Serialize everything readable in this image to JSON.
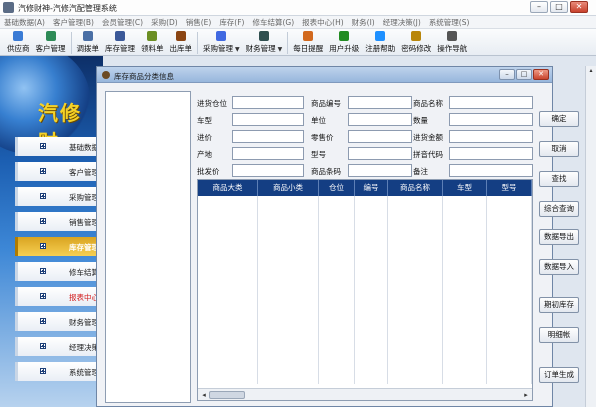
{
  "window": {
    "title": "汽修财神-汽修汽配管理系统",
    "buttons": {
      "min": "–",
      "max": "□",
      "close": "✕"
    }
  },
  "menubar": [
    "基础数据(A)",
    "客户管理(B)",
    "会员管理(C)",
    "采购(D)",
    "销售(E)",
    "库存(F)",
    "修车结算(G)",
    "报表中心(H)",
    "财务(I)",
    "经理决策(J)",
    "系统管理(S)"
  ],
  "toolbar": [
    {
      "label": "供应商",
      "icon": "supplier-icon",
      "color": "#3a7bd5"
    },
    {
      "label": "客户管理",
      "icon": "customer-icon",
      "color": "#2e8b57"
    },
    {
      "sep": true
    },
    {
      "label": "调拨单",
      "icon": "transfer-icon",
      "color": "#4a6fa5"
    },
    {
      "label": "库存管理",
      "icon": "inventory-icon",
      "color": "#3b5998"
    },
    {
      "label": "领料单",
      "icon": "requisition-icon",
      "color": "#6b8e23"
    },
    {
      "label": "出库单",
      "icon": "outbound-icon",
      "color": "#8b4513"
    },
    {
      "sep": true
    },
    {
      "label": "采购管理",
      "icon": "purchase-icon",
      "color": "#4169e1",
      "dropdown": true
    },
    {
      "label": "财务管理",
      "icon": "finance-icon",
      "color": "#2f4f4f",
      "dropdown": true
    },
    {
      "sep": true
    },
    {
      "label": "每日提醒",
      "icon": "reminder-icon",
      "color": "#d2691e"
    },
    {
      "label": "用户升级",
      "icon": "upgrade-icon",
      "color": "#228b22"
    },
    {
      "label": "注册帮助",
      "icon": "help-icon",
      "color": "#1e90ff"
    },
    {
      "label": "密码修改",
      "icon": "password-icon",
      "color": "#b8860b"
    },
    {
      "label": "操作导航",
      "icon": "navigation-icon",
      "color": "#555555"
    }
  ],
  "brand": "汽修财",
  "nav": [
    {
      "label": "基础数据",
      "state": "normal"
    },
    {
      "label": "客户管理",
      "state": "normal"
    },
    {
      "label": "采购管理",
      "state": "normal"
    },
    {
      "label": "销售管理",
      "state": "normal"
    },
    {
      "label": "库存管理",
      "state": "active"
    },
    {
      "label": "修车结算",
      "state": "normal"
    },
    {
      "label": "报表中心",
      "state": "red"
    },
    {
      "label": "财务管理",
      "state": "normal"
    },
    {
      "label": "经理决策",
      "state": "normal"
    },
    {
      "label": "系统管理",
      "state": "normal"
    }
  ],
  "dialog": {
    "title": "库存商品分类信息",
    "buttons": {
      "min": "–",
      "max": "□",
      "close": "✕"
    }
  },
  "form": {
    "col1": [
      {
        "label": "进货仓位",
        "value": ""
      },
      {
        "label": "车型",
        "value": ""
      },
      {
        "label": "进价",
        "value": ""
      },
      {
        "label": "产地",
        "value": ""
      },
      {
        "label": "批发价",
        "value": ""
      }
    ],
    "col2": [
      {
        "label": "商品编号",
        "value": ""
      },
      {
        "label": "单位",
        "value": ""
      },
      {
        "label": "零售价",
        "value": ""
      },
      {
        "label": "型号",
        "value": ""
      },
      {
        "label": "商品条码",
        "value": ""
      }
    ],
    "col3": [
      {
        "label": "商品名称",
        "value": ""
      },
      {
        "label": "数量",
        "value": ""
      },
      {
        "label": "进货金额",
        "value": ""
      },
      {
        "label": "拼音代码",
        "value": ""
      },
      {
        "label": "备注",
        "value": ""
      }
    ]
  },
  "grid": {
    "columns": [
      "商品大类",
      "商品小类",
      "仓位",
      "编号",
      "商品名称",
      "车型",
      "型号"
    ],
    "rows": [],
    "scroll": {
      "left": "◂",
      "right": "▸"
    }
  },
  "side_buttons": [
    "确定",
    "取消",
    "查找",
    "综合查询",
    "数据导出",
    "数据导入",
    "期初库存",
    "明细帐",
    "订单生成"
  ],
  "vscroll": {
    "up": "▴"
  }
}
